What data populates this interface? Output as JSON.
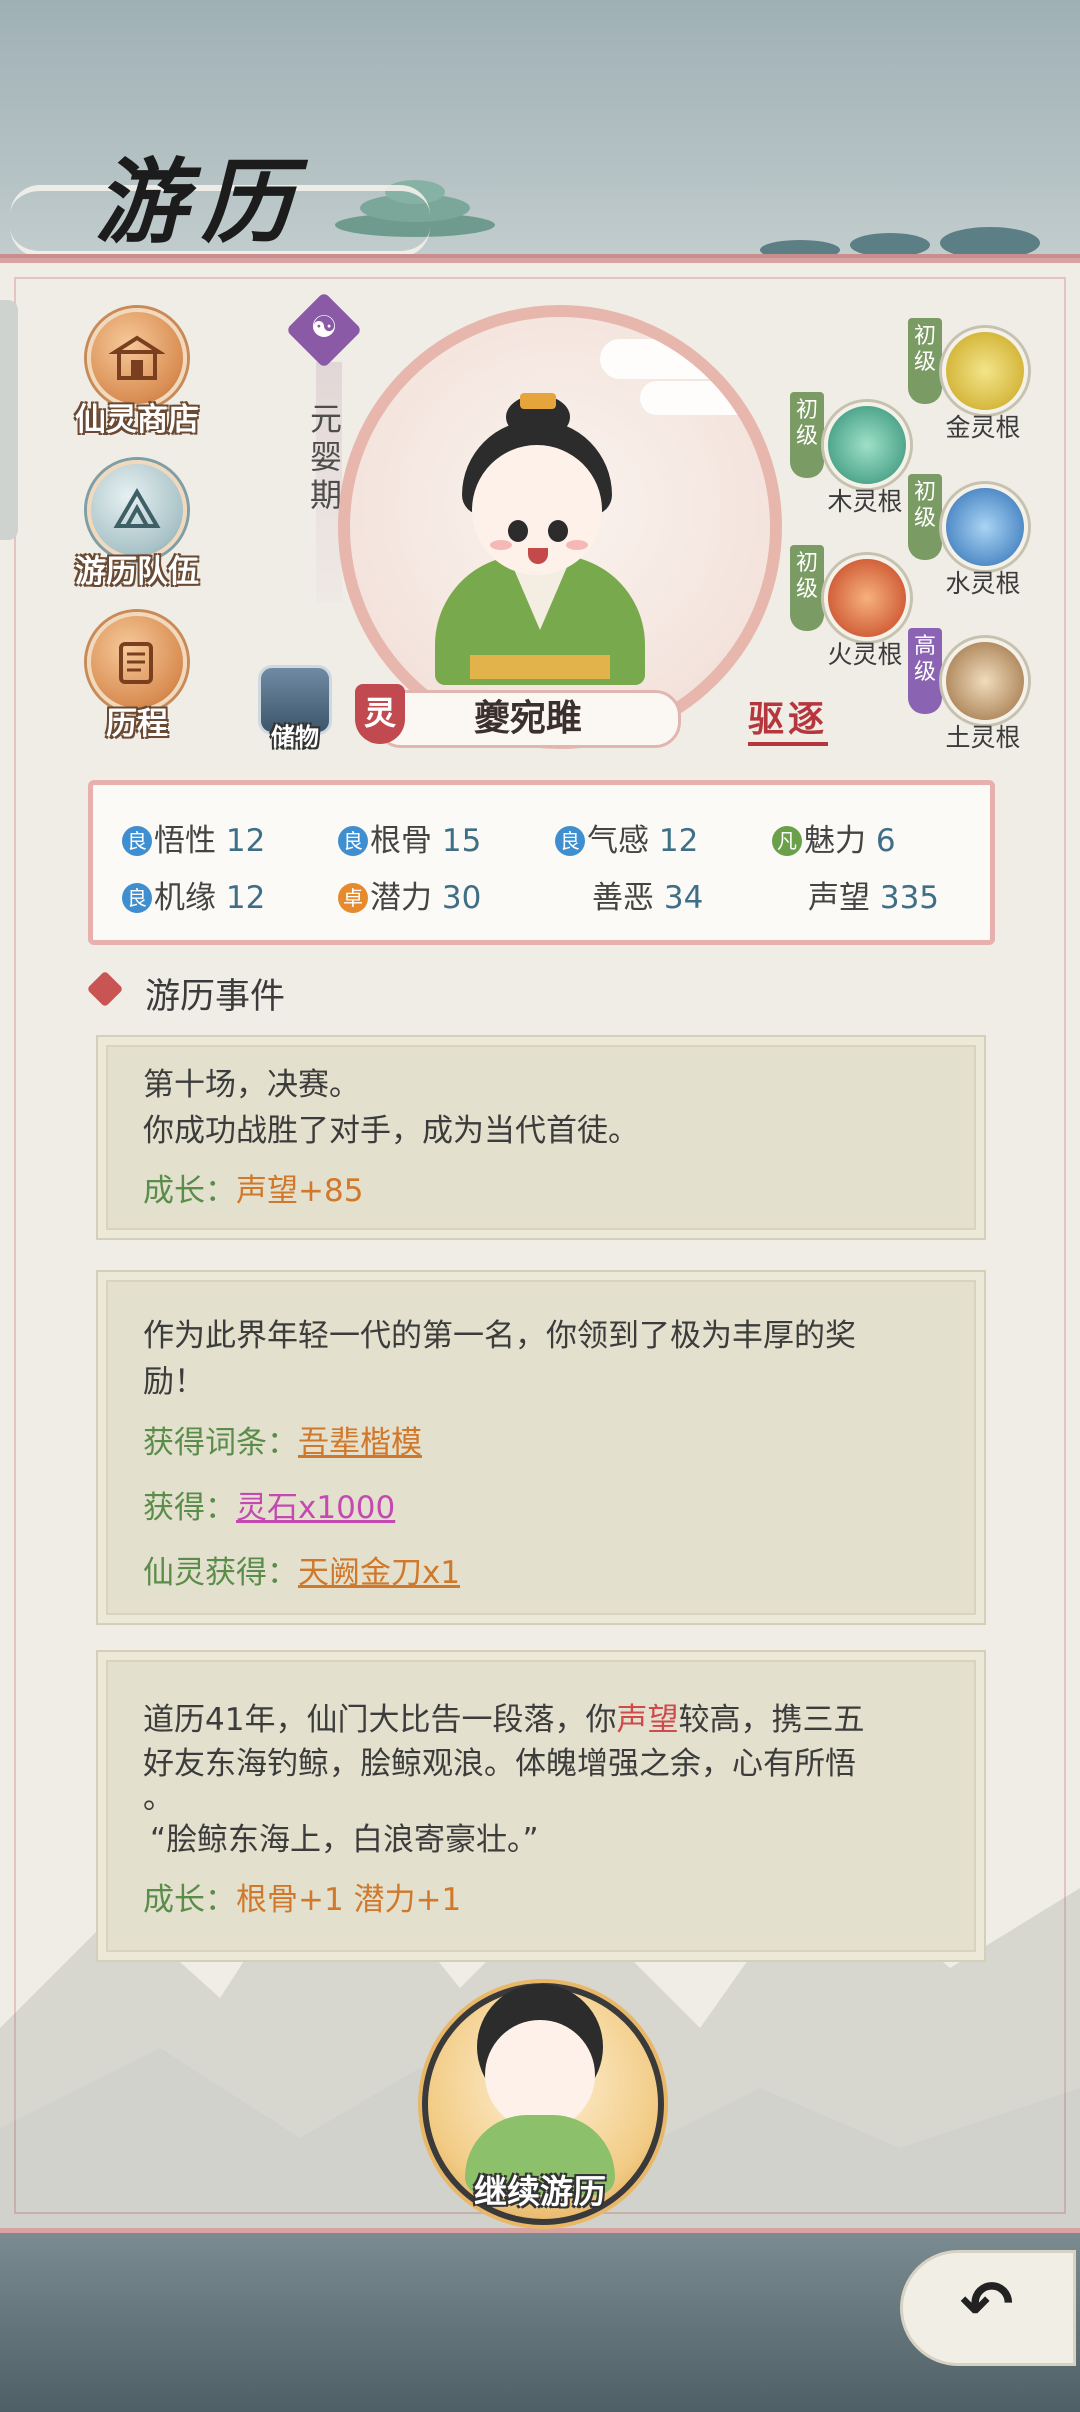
{
  "header": {
    "title": "游历"
  },
  "menu": [
    {
      "label": "仙灵商店",
      "icon": "shop-icon"
    },
    {
      "label": "游历队伍",
      "icon": "team-icon"
    },
    {
      "label": "历程",
      "icon": "scroll-icon"
    }
  ],
  "character": {
    "realm": "元婴期",
    "name": "夔宛雎",
    "spirit_badge": "灵",
    "storage_label": "储物",
    "expel_label": "驱逐"
  },
  "roots": [
    {
      "tag": "初级",
      "label": "金灵根",
      "color": "#e0c43a"
    },
    {
      "tag": "初级",
      "label": "木灵根",
      "color": "#3fae8e"
    },
    {
      "tag": "初级",
      "label": "水灵根",
      "color": "#3b86c8"
    },
    {
      "tag": "初级",
      "label": "火灵根",
      "color": "#d0552f"
    },
    {
      "tag": "高级",
      "label": "土灵根",
      "color": "#b88a5a"
    }
  ],
  "stats": [
    {
      "badge": "良",
      "name": "悟性",
      "value": "12"
    },
    {
      "badge": "良",
      "name": "根骨",
      "value": "15"
    },
    {
      "badge": "良",
      "name": "气感",
      "value": "12"
    },
    {
      "badge": "凡",
      "name": "魅力",
      "value": "6"
    },
    {
      "badge": "良",
      "name": "机缘",
      "value": "12"
    },
    {
      "badge": "卓",
      "name": "潜力",
      "value": "30"
    },
    {
      "badge": "",
      "name": "善恶",
      "value": "34"
    },
    {
      "badge": "",
      "name": "声望",
      "value": "335"
    }
  ],
  "events_title": "游历事件",
  "events": {
    "e1": {
      "line1": "第十场，决赛。",
      "line2": "你成功战胜了对手，成为当代首徒。",
      "growth_label": "成长：",
      "growth_value": "声望+85"
    },
    "e2": {
      "line1": "作为此界年轻一代的第一名，你领到了极为丰厚的奖",
      "line2": "励！",
      "gain_title_label": "获得词条：",
      "gain_title_value": "吾辈楷模",
      "gain_label": "获得：",
      "gain_value": "灵石x1000",
      "spirit_gain_label": "仙灵获得：",
      "spirit_gain_value": "天阙金刀x1"
    },
    "e3": {
      "line1a": "道历41年，仙门大比告一段落，你",
      "line1b": "声望",
      "line1c": "较高，携三五",
      "line2": "好友东海钓鲸，脍鲸观浪。体魄增强之余，心有所悟",
      "line3": "。",
      "line4": "“脍鲸东海上，白浪寄豪壮。”",
      "growth_label": "成长：",
      "growth_a": "根骨+1",
      "growth_b": "潜力+1"
    }
  },
  "continue_label": "继续游历"
}
